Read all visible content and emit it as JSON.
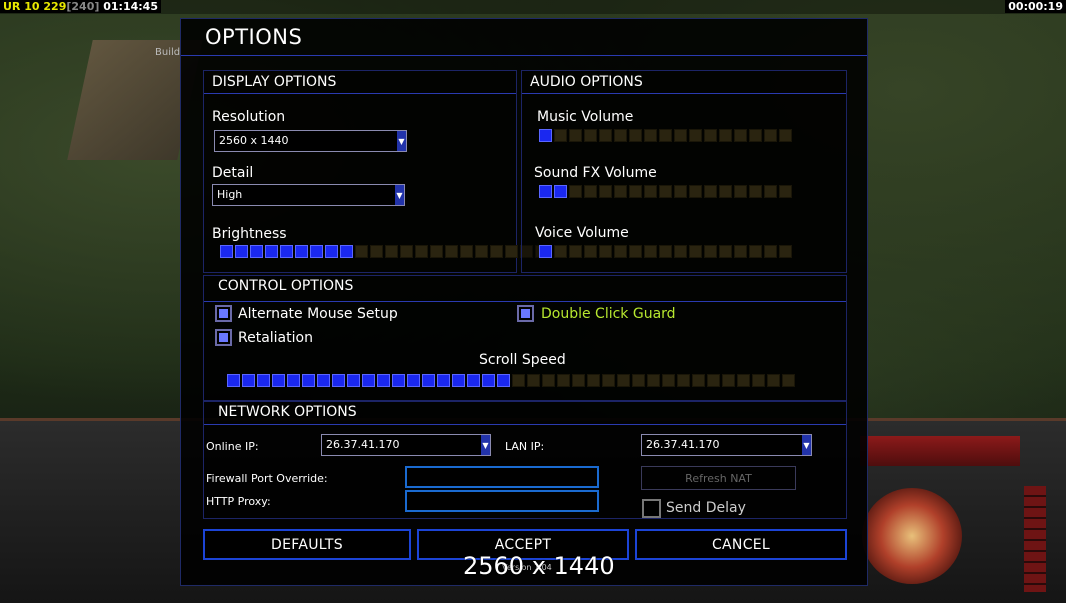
{
  "hud": {
    "ur": "UR",
    "level": "10",
    "credits": "229",
    "credits_bracket": "[240]",
    "elapsed": "01:14:45",
    "timer": "00:00:19"
  },
  "background": {
    "build_label": "Build"
  },
  "dialog": {
    "title": "OPTIONS",
    "display": {
      "header": "DISPLAY OPTIONS",
      "resolution_label": "Resolution",
      "resolution_value": "2560 x 1440",
      "detail_label": "Detail",
      "detail_value": "High",
      "brightness_label": "Brightness",
      "brightness_level": 9,
      "brightness_max": 22
    },
    "audio": {
      "header": "AUDIO OPTIONS",
      "music_label": "Music Volume",
      "music_level": 1,
      "sfx_label": "Sound FX Volume",
      "sfx_level": 2,
      "voice_label": "Voice Volume",
      "voice_level": 1,
      "max": 17
    },
    "control": {
      "header": "CONTROL OPTIONS",
      "alt_mouse_label": "Alternate Mouse Setup",
      "alt_mouse_checked": true,
      "double_click_label": "Double Click Guard",
      "double_click_checked": true,
      "retaliation_label": "Retaliation",
      "retaliation_checked": true,
      "scroll_label": "Scroll Speed",
      "scroll_level": 19,
      "scroll_max": 38
    },
    "network": {
      "header": "NETWORK OPTIONS",
      "online_ip_label": "Online IP:",
      "online_ip_value": "26.37.41.170",
      "lan_ip_label": "LAN IP:",
      "lan_ip_value": "26.37.41.170",
      "firewall_label": "Firewall Port Override:",
      "firewall_value": "",
      "http_proxy_label": "HTTP Proxy:",
      "http_proxy_value": "",
      "refresh_nat_label": "Refresh NAT",
      "send_delay_label": "Send Delay",
      "send_delay_checked": false
    },
    "buttons": {
      "defaults": "DEFAULTS",
      "accept": "ACCEPT",
      "cancel": "CANCEL"
    },
    "version_text": "Version 1.04"
  },
  "overlay_resolution": "2560 x 1440",
  "colors": {
    "accent_blue": "#1a28f0",
    "border_blue": "#1c44d6",
    "double_click_green": "#b8e830"
  }
}
